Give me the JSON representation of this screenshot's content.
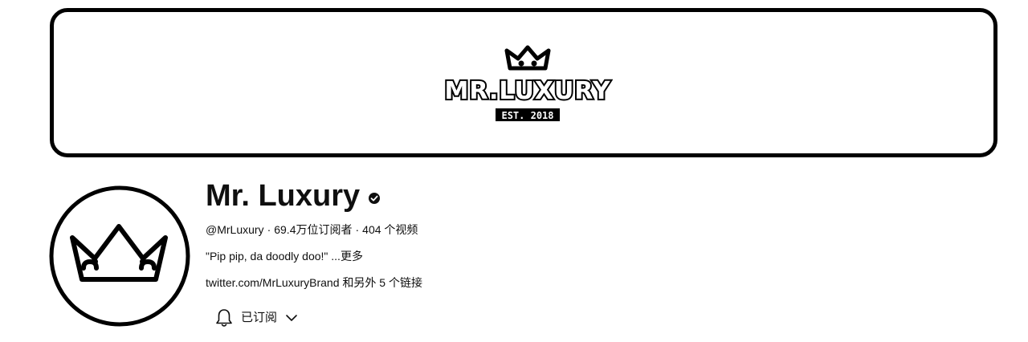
{
  "banner": {
    "brand_text": "MR.LUXURY",
    "est_text": "EST. 2018"
  },
  "channel": {
    "name": "Mr. Luxury",
    "handle": "@MrLuxury",
    "subscribers": "69.4万位订阅者",
    "videos": "404 个视频",
    "separator": "·",
    "description": "\"Pip pip, da doodly doo!\" ...",
    "more_label": "更多",
    "link_url": "twitter.com/MrLuxuryBrand",
    "link_more": "和另外 5 个链接"
  },
  "subscribe_button": {
    "label": "已订阅",
    "bell_icon": "bell-icon",
    "dropdown_icon": "chevron-down-icon"
  }
}
